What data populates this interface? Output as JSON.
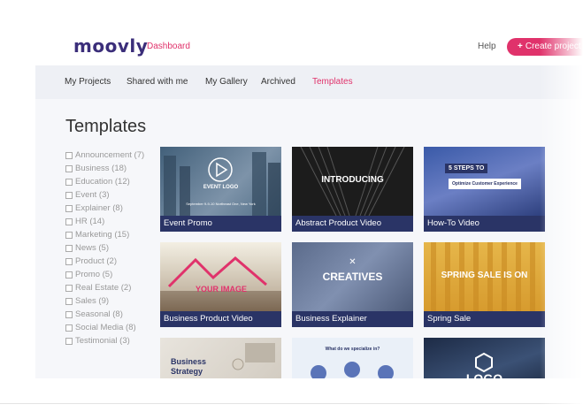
{
  "header": {
    "logo": "moovly",
    "dashboard_label": "Dashboard",
    "help_label": "Help",
    "create_label": "Create project",
    "create_icon": "plus-icon"
  },
  "nav": {
    "items": [
      {
        "label": "My Projects"
      },
      {
        "label": "Shared with me"
      },
      {
        "label": "My Gallery"
      },
      {
        "label": "Archived"
      },
      {
        "label": "Templates",
        "active": true
      }
    ]
  },
  "main": {
    "title": "Templates",
    "filters": [
      {
        "label": "Announcement (7)"
      },
      {
        "label": "Business (18)"
      },
      {
        "label": "Education (12)"
      },
      {
        "label": "Event (3)"
      },
      {
        "label": "Explainer (8)"
      },
      {
        "label": "HR (14)"
      },
      {
        "label": "Marketing (15)"
      },
      {
        "label": "News (5)"
      },
      {
        "label": "Product (2)"
      },
      {
        "label": "Promo (5)"
      },
      {
        "label": "Real Estate (2)"
      },
      {
        "label": "Sales (9)"
      },
      {
        "label": "Seasonal (8)"
      },
      {
        "label": "Social Media (8)"
      },
      {
        "label": "Testimonial (3)"
      }
    ],
    "templates": [
      {
        "caption": "Event Promo",
        "thumb_text": "EVENT LOGO",
        "thumb_sub": "September 9-9-10 Northeast One, New York"
      },
      {
        "caption": "Abstract Product Video",
        "thumb_text": "INTRODUCING"
      },
      {
        "caption": "How-To Video",
        "thumb_text": "5 STEPS TO",
        "thumb_sub": "Optimize Customer Experience"
      },
      {
        "caption": "Business Product Video",
        "thumb_text": "YOUR IMAGE"
      },
      {
        "caption": "Business Explainer",
        "thumb_text": "CREATIVES"
      },
      {
        "caption": "Spring Sale",
        "thumb_text": "SPRING SALE IS ON"
      },
      {
        "caption": "",
        "thumb_text": "Business Strategy"
      },
      {
        "caption": "",
        "thumb_text": "What do we specialize in?"
      },
      {
        "caption": "",
        "thumb_text": "LOGO"
      }
    ]
  },
  "colors": {
    "accent": "#e0326b",
    "brand": "#3b2e7a",
    "caption_bg": "#2a3466",
    "nav_bg": "#eef0f5"
  }
}
